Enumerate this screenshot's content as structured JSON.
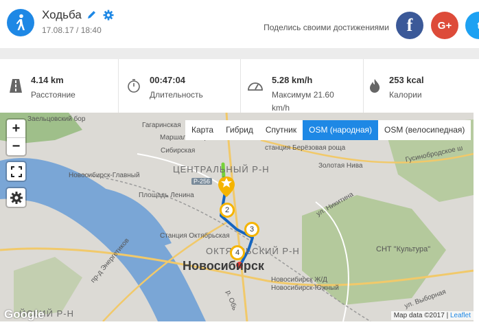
{
  "header": {
    "title": "Ходьба",
    "date": "17.08.17 / 18:40",
    "share_text": "Поделись своими достижениями",
    "activity_icon": "walking-person-icon",
    "social": [
      "facebook",
      "google-plus",
      "twitter"
    ],
    "facebook_glyph": "f",
    "google_glyph": "G+",
    "twitter_glyph": "t"
  },
  "stats": [
    {
      "value": "4.14 km",
      "label": "Расстояние",
      "icon": "road-icon"
    },
    {
      "value": "00:47:04",
      "label": "Длительность",
      "icon": "stopwatch-icon"
    },
    {
      "value": "5.28 km/h",
      "label": "Максимум 21.60 km/h",
      "icon": "speedometer-icon"
    },
    {
      "value": "253 kcal",
      "label": "Калории",
      "icon": "flame-icon"
    }
  ],
  "map": {
    "zoom_in": "+",
    "zoom_out": "−",
    "layers": [
      "Карта",
      "Гибрид",
      "Спутник",
      "OSM (народная)",
      "OSM (велосипедная)"
    ],
    "active_layer": "OSM (народная)",
    "labels": {
      "zaeltsovsky": "Заельцовский бор",
      "gagarinskaya": "Гагаринская",
      "marshala": "Маршала Покрышкина",
      "sibirskaya": "Сибирская",
      "novosibirsk_main": "Новосибирск-Главный",
      "r256": "Р-256",
      "lenina": "Площадь Ленина",
      "oktyabrskaya": "Станция Октябрьская",
      "berezovaya": "станция Берёзовая роща",
      "zolotaya": "Золотая Нива",
      "gusinobrodskoe": "Гусинобродское ш",
      "nikitina": "ул. Никитина",
      "snt": "СНТ \"Культура\"",
      "zhd": "Новосибирск Ж/Д",
      "yuzhny": "Новосибирск-Южный",
      "energetikov": "пр-д Энергетиков",
      "ob": "р. Обь",
      "vyborna": "ул. Выборная",
      "oktyabrskaya_street": "Октябрьская"
    },
    "districts": {
      "central": "ЦЕНТРАЛЬНЫЙ Р-Н",
      "october": "ОКТЯБРЬСКИЙ Р-Н",
      "left": "ЙСКИЙ Р-Н"
    },
    "city": "Новосибирск",
    "markers": [
      "2",
      "3",
      "4"
    ],
    "google": "Google",
    "attribution": "Map data ©2017",
    "leaflet": "Leaflet",
    "route_color": "#1565c0",
    "start_color": "#76d13a",
    "end_color": "#e53935"
  }
}
